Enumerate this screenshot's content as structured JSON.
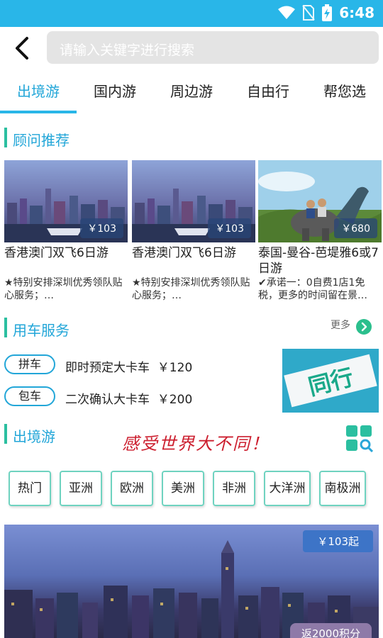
{
  "status_bar": {
    "time": "6:48"
  },
  "search": {
    "placeholder": "请输入关键字进行搜索"
  },
  "tabs": [
    {
      "label": "出境游",
      "active": true
    },
    {
      "label": "国内游"
    },
    {
      "label": "周边游"
    },
    {
      "label": "自由行"
    },
    {
      "label": "帮您选"
    }
  ],
  "advisor": {
    "title": "顾问推荐",
    "cards": [
      {
        "title": "香港澳门双飞6日游",
        "price": "￥103",
        "desc": "★特别安排深圳优秀领队贴心服务；…"
      },
      {
        "title": "香港澳门双飞6日游",
        "price": "￥103",
        "desc": "★特别安排深圳优秀领队贴心服务；…"
      },
      {
        "title": "泰国-曼谷-芭堤雅6或7日游",
        "price": "￥680",
        "desc": "✔承诺一：0自费1店1免税，更多的时间留在景…"
      }
    ]
  },
  "car_service": {
    "title": "用车服务",
    "more": "更多",
    "items": [
      {
        "tag": "拼车",
        "text": "即时预定大卡车",
        "price": "￥120"
      },
      {
        "tag": "包车",
        "text": "二次确认大卡车",
        "price": "￥200"
      }
    ],
    "banner_text": "同行"
  },
  "outbound": {
    "title": "出境游",
    "slogan": "感受世界大不同！",
    "regions": [
      "热门",
      "亚洲",
      "欧洲",
      "美洲",
      "非洲",
      "大洋洲",
      "南极洲"
    ],
    "banner_price": "￥103起",
    "banner_points": "返2000积分"
  }
}
